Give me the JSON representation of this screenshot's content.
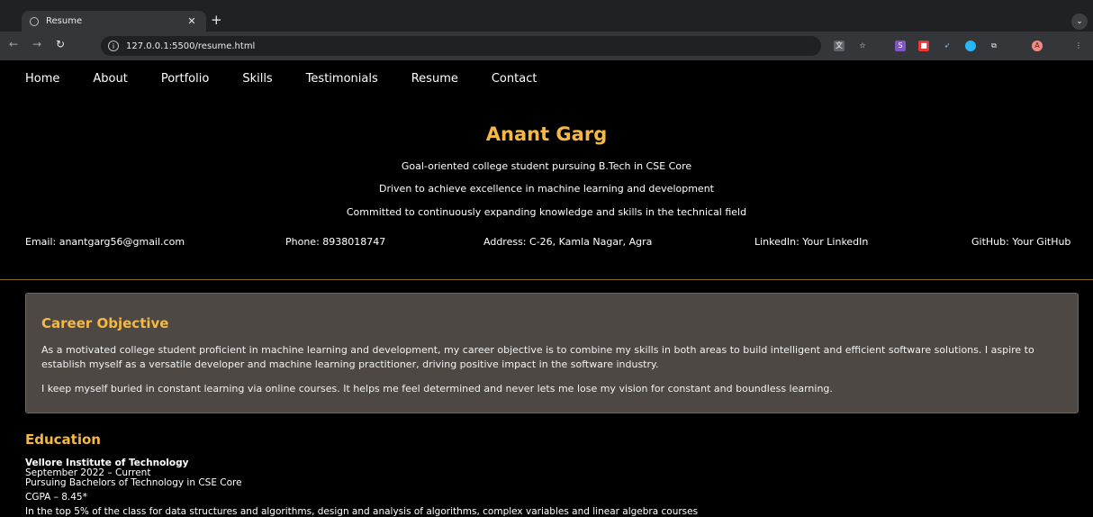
{
  "browser": {
    "tab_title": "Resume",
    "url": "127.0.0.1:5500/resume.html",
    "profile_initial": "A"
  },
  "nav": [
    "Home",
    "About",
    "Portfolio",
    "Skills",
    "Testimonials",
    "Resume",
    "Contact"
  ],
  "header": {
    "name": "Anant Garg",
    "taglines": [
      "Goal-oriented college student pursuing B.Tech in CSE Core",
      "Driven to achieve excellence in machine learning and development",
      "Committed to continuously expanding knowledge and skills in the technical field"
    ],
    "email": "Email: anantgarg56@gmail.com",
    "phone": "Phone: 8938018747",
    "address": "Address: C-26, Kamla Nagar, Agra",
    "linkedin": "LinkedIn: Your LinkedIn",
    "github": "GitHub: Your GitHub"
  },
  "objective": {
    "heading": "Career Objective",
    "p1": "As a motivated college student proficient in machine learning and development, my career objective is to combine my skills in both areas to build intelligent and efficient software solutions. I aspire to establish myself as a versatile developer and machine learning practitioner, driving positive impact in the software industry.",
    "p2": "I keep myself buried in constant learning via online courses. It helps me feel determined and never lets me lose my vision for constant and boundless learning."
  },
  "education": {
    "heading": "Education",
    "institution": "Vellore Institute of Technology",
    "dates": "September 2022 – Current",
    "degree": "Pursuing Bachelors of Technology in CSE Core",
    "cgpa": "CGPA – 8.45*",
    "note": "In the top 5% of the class for data structures and algorithms, design and analysis of algorithms, complex variables and linear algebra courses"
  },
  "colors": {
    "accent": "#f5b942",
    "panel": "#4d4844"
  }
}
